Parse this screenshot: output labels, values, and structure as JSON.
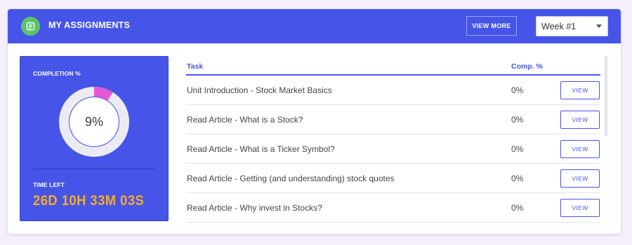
{
  "header": {
    "title": "MY ASSIGNMENTS",
    "view_more_label": "VIEW MORE",
    "week_selected": "Week #1",
    "icon": "assignment-icon"
  },
  "stats": {
    "completion_label": "COMPLETION %",
    "completion_value": 9,
    "completion_text": "9%",
    "time_left_label": "TIME LEFT",
    "time_left_value": "26D 10H 33M 03S"
  },
  "table": {
    "columns": [
      "Task",
      "Comp. %"
    ],
    "rows": [
      {
        "task": "Unit Introduction - Stock Market Basics",
        "comp": "0%",
        "action": "VIEW"
      },
      {
        "task": "Read Article - What is a Stock?",
        "comp": "0%",
        "action": "VIEW"
      },
      {
        "task": "Read Article - What is a Ticker Symbol?",
        "comp": "0%",
        "action": "VIEW"
      },
      {
        "task": "Read Article - Getting (and understanding) stock quotes",
        "comp": "0%",
        "action": "VIEW"
      },
      {
        "task": "Read Article - Why invest in Stocks?",
        "comp": "0%",
        "action": "VIEW"
      }
    ]
  },
  "colors": {
    "primary": "#4655e8",
    "accent_pink": "#e25ad8",
    "time_orange": "#f7a928",
    "icon_green": "#5cc46b",
    "background": "#f6effa"
  }
}
